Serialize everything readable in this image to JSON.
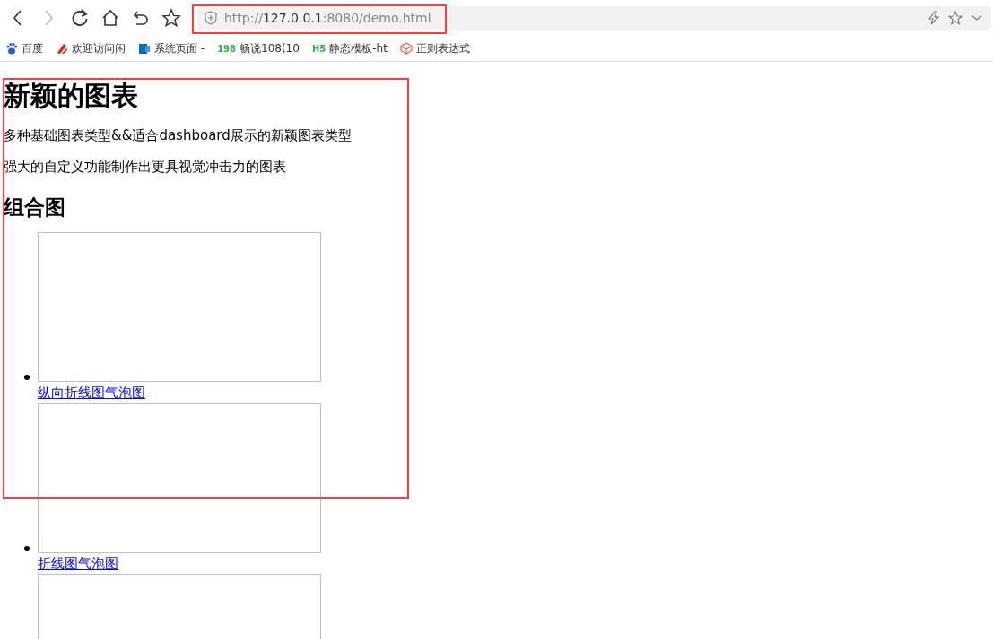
{
  "toolbar": {
    "buttons": [
      {
        "kind": "back",
        "disabled": false
      },
      {
        "kind": "forward",
        "disabled": true
      },
      {
        "kind": "reload",
        "disabled": false
      },
      {
        "kind": "home",
        "disabled": false
      },
      {
        "kind": "undo",
        "disabled": false
      },
      {
        "kind": "bookmark",
        "disabled": false
      }
    ],
    "address": {
      "scheme": "http://",
      "host": "127.0.0.1",
      "rest": ":8080/demo.html"
    }
  },
  "bookmarks": [
    {
      "kind": "paw",
      "label": "百度"
    },
    {
      "kind": "swoosh",
      "label": "欢迎访问闲"
    },
    {
      "kind": "s-logo",
      "label": "系统页面 -"
    },
    {
      "kind": "text-logo",
      "icon_text": "198",
      "label": "畅说108(10"
    },
    {
      "kind": "text-logo",
      "icon_text": "H5",
      "label": "静态模板-ht"
    },
    {
      "kind": "cube",
      "label": "正则表达式"
    }
  ],
  "page": {
    "title": "新颖的图表",
    "paragraphs": [
      "多种基础图表类型&&适合dashboard展示的新颖图表类型",
      "强大的自定义功能制作出更具视觉冲击力的图表"
    ],
    "section_title": "组合图",
    "items": [
      {
        "kind": "link-item",
        "link": "纵向折线图气泡图"
      },
      {
        "kind": "link-item",
        "link": "折线图气泡图"
      },
      {
        "kind": "image-only"
      }
    ]
  }
}
